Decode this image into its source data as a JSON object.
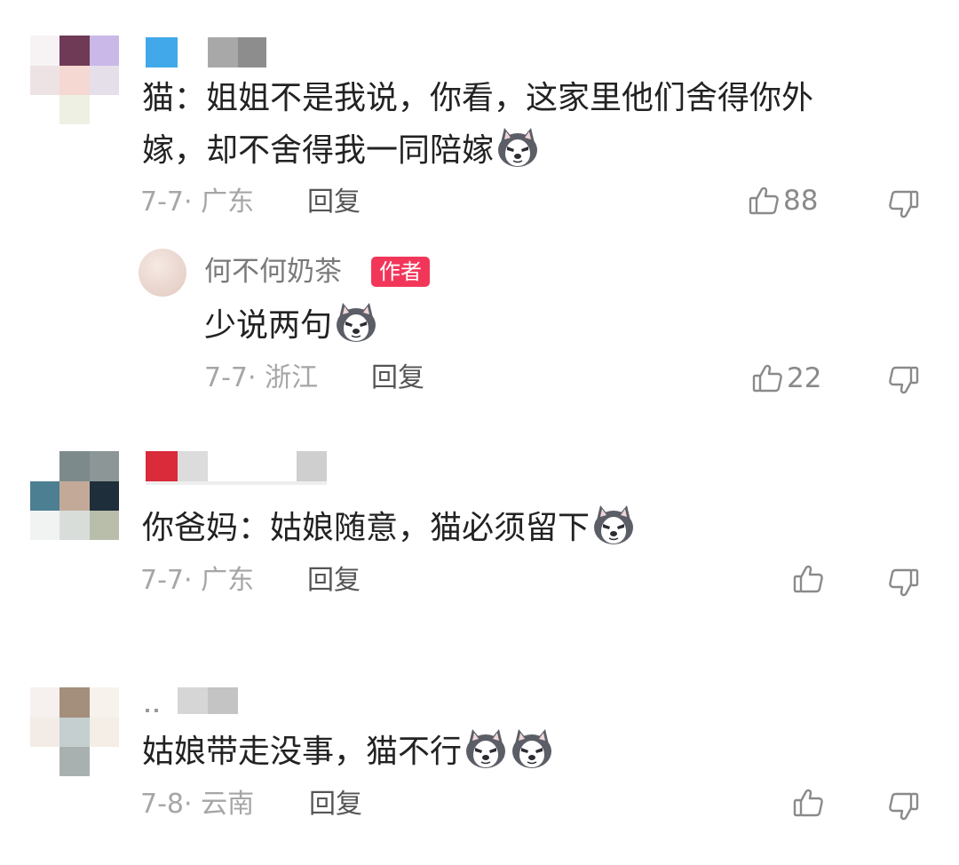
{
  "colors": {
    "author_badge": "#f2365a",
    "meta_text": "#a6a6a6",
    "icon": "#8a8a8a"
  },
  "comments": [
    {
      "text": "猫：姐姐不是我说，你看，这家里他们舍得你外",
      "text_line2": "嫁，却不舍得我一同陪嫁",
      "emoji": "husky-emoji",
      "date": "7-7",
      "location": "广东",
      "reply_label": "回复",
      "likes": "88"
    },
    {
      "username": "何不何奶茶",
      "badge": "作者",
      "text": "少说两句",
      "emoji": "husky-emoji",
      "date": "7-7",
      "location": "浙江",
      "reply_label": "回复",
      "likes": "22"
    },
    {
      "text": "你爸妈：姑娘随意，猫必须留下",
      "emoji": "husky-emoji",
      "date": "7-7",
      "location": "广东",
      "reply_label": "回复",
      "likes": ""
    },
    {
      "text": "姑娘带走没事，猫不行",
      "emoji": "husky-emoji",
      "emoji_count": 2,
      "date": "7-8",
      "location": "云南",
      "reply_label": "回复",
      "likes": ""
    }
  ]
}
